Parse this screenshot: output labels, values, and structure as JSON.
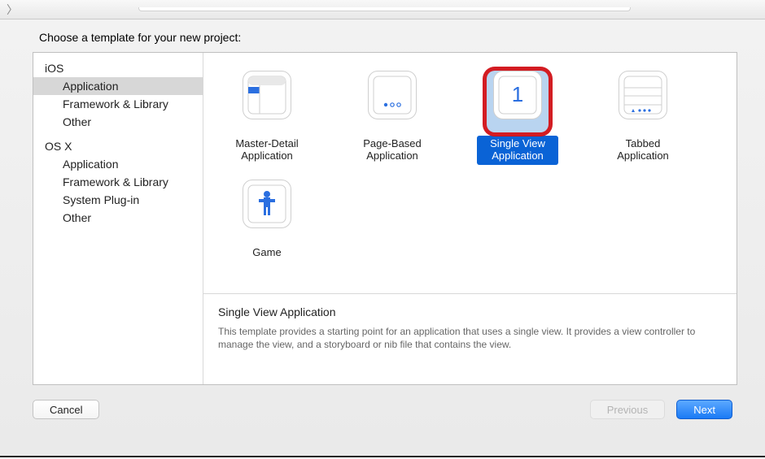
{
  "prompt": "Choose a template for your new project:",
  "sidebar": {
    "groups": [
      {
        "name": "iOS",
        "items": [
          {
            "label": "Application",
            "selected": true
          },
          {
            "label": "Framework & Library",
            "selected": false
          },
          {
            "label": "Other",
            "selected": false
          }
        ]
      },
      {
        "name": "OS X",
        "items": [
          {
            "label": "Application",
            "selected": false
          },
          {
            "label": "Framework & Library",
            "selected": false
          },
          {
            "label": "System Plug-in",
            "selected": false
          },
          {
            "label": "Other",
            "selected": false
          }
        ]
      }
    ]
  },
  "templates": [
    {
      "icon": "master-detail-icon",
      "label": "Master-Detail Application",
      "selected": false
    },
    {
      "icon": "page-based-icon",
      "label": "Page-Based Application",
      "selected": false
    },
    {
      "icon": "single-view-icon",
      "label": "Single View Application",
      "selected": true
    },
    {
      "icon": "tabbed-icon",
      "label": "Tabbed Application",
      "selected": false
    },
    {
      "icon": "game-icon",
      "label": "Game",
      "selected": false
    }
  ],
  "description": {
    "title": "Single View Application",
    "body": "This template provides a starting point for an application that uses a single view. It provides a view controller to manage the view, and a storyboard or nib file that contains the view."
  },
  "buttons": {
    "cancel": "Cancel",
    "previous": "Previous",
    "next": "Next"
  }
}
